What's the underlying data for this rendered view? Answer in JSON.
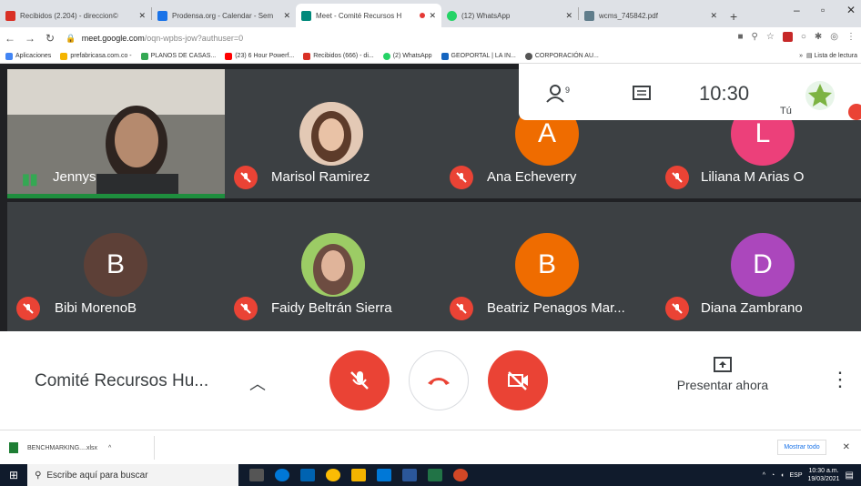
{
  "browser": {
    "tabs": [
      {
        "title": "Recibidos (2.204) - direccion©",
        "color": "#d93025",
        "active": false,
        "recording": false
      },
      {
        "title": "Prodensa.org - Calendar - Sem",
        "color": "#1a73e8",
        "active": false,
        "recording": false
      },
      {
        "title": "Meet - Comité Recursos H",
        "color": "#00897b",
        "active": true,
        "recording": true
      },
      {
        "title": "(12) WhatsApp",
        "color": "#25d366",
        "active": false,
        "recording": false
      },
      {
        "title": "wcms_745842.pdf",
        "color": "#607d8b",
        "active": false,
        "recording": false
      }
    ],
    "url_host": "meet.google.com",
    "url_path": "/oqn-wpbs-jow?authuser=0",
    "bookmarks": [
      {
        "label": "Aplicaciones",
        "color": "#4285f4"
      },
      {
        "label": "prefabricasa.com.co -",
        "color": "#f4b400"
      },
      {
        "label": "PLANOS DE CASAS...",
        "color": "#34a853"
      },
      {
        "label": "(23) 6 Hour Powerf...",
        "color": "#ff0000"
      },
      {
        "label": "Recibidos (666) - di...",
        "color": "#d93025"
      },
      {
        "label": "(2) WhatsApp",
        "color": "#25d366"
      },
      {
        "label": "GEOPORTAL | LA IN...",
        "color": "#1565c0"
      },
      {
        "label": "CORPORACIÓN AU...",
        "color": "#555555"
      }
    ],
    "reading_list": "Lista de lectura"
  },
  "meet": {
    "time": "10:30",
    "self_label": "Tú",
    "participants": [
      {
        "name": "Jennys",
        "initial": "",
        "avatar_color": "",
        "type": "video",
        "speaking": true
      },
      {
        "name": "Marisol Ramirez",
        "initial": "",
        "avatar_color": "",
        "type": "photo"
      },
      {
        "name": "Ana Echeverry",
        "initial": "A",
        "avatar_color": "#ef6c00",
        "type": "letter"
      },
      {
        "name": "Liliana M Arias O",
        "initial": "L",
        "avatar_color": "#ec407a",
        "type": "letter"
      },
      {
        "name": "Bibi MorenoB",
        "initial": "B",
        "avatar_color": "#5d4037",
        "type": "letter"
      },
      {
        "name": "Faidy Beltrán Sierra",
        "initial": "",
        "avatar_color": "",
        "type": "photo"
      },
      {
        "name": "Beatriz Penagos Mar...",
        "initial": "B",
        "avatar_color": "#ef6c00",
        "type": "letter"
      },
      {
        "name": "Diana Zambrano",
        "initial": "D",
        "avatar_color": "#ab47bc",
        "type": "letter"
      }
    ],
    "meeting_title": "Comité Recursos Hu...",
    "present_label": "Presentar ahora"
  },
  "downloads": {
    "file": "BENCHMARKING....xlsx",
    "show_all": "Mostrar todo"
  },
  "taskbar": {
    "search_placeholder": "Escribe aquí para buscar",
    "lang": "ESP",
    "clock_time": "10:30 a.m.",
    "clock_date": "19/03/2021"
  }
}
